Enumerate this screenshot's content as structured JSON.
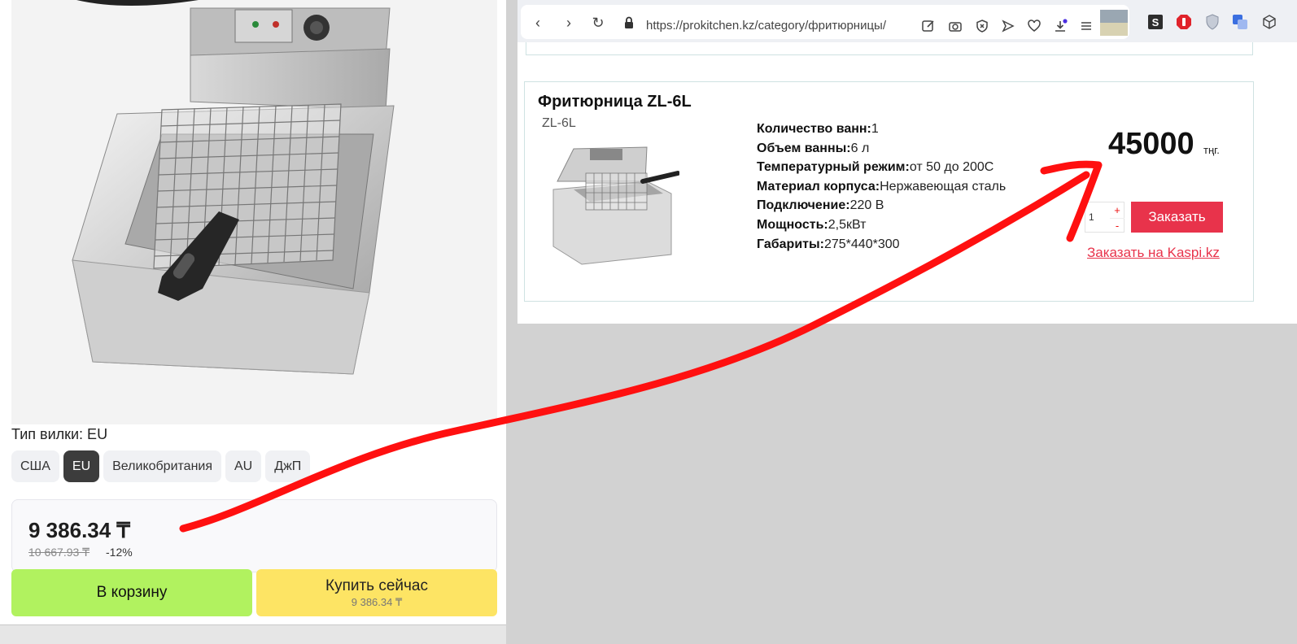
{
  "left_panel": {
    "plug_type_label": "Тип вилки: EU",
    "plug_options": [
      "США",
      "EU",
      "Великобритания",
      "AU",
      "ДжП"
    ],
    "selected_plug": "EU",
    "price": {
      "current": "9 386.34 ₸",
      "old": "10 667.93 ₸",
      "discount": "-12%"
    },
    "buttons": {
      "cart": "В корзину",
      "buy_now": "Купить сейчас",
      "buy_now_sub": "9 386.34 ₸"
    }
  },
  "browser": {
    "url": "https://prokitchen.kz/category/фритюрницы/",
    "toolbar_icons": [
      "edit-icon",
      "camera-icon",
      "shield-x-icon",
      "send-icon",
      "heart-icon",
      "download-icon",
      "menu-icon"
    ],
    "extension_icons": [
      "s-extension-icon",
      "stop-extension-icon",
      "shield-extension-icon",
      "translate-extension-icon",
      "cube-extension-icon"
    ]
  },
  "product_card": {
    "title": "Фритюрница ZL-6L",
    "model": "ZL-6L",
    "specs": [
      {
        "label": "Количество ванн:",
        "value": "1"
      },
      {
        "label": "Объем ванны:",
        "value": "6 л"
      },
      {
        "label": "Температурный режим:",
        "value": "от 50 до 200С"
      },
      {
        "label": "Материал корпуса:",
        "value": "Нержавеющая сталь"
      },
      {
        "label": "Подключение:",
        "value": "220 В"
      },
      {
        "label": "Мощность:",
        "value": "2,5кВт"
      },
      {
        "label": "Габариты:",
        "value": "275*440*300"
      }
    ],
    "price": "45000",
    "currency": "тңг.",
    "quantity": "1",
    "qty_plus": "+",
    "qty_minus": "-",
    "order_button": "Заказать",
    "kaspi_link": "Заказать на Kaspi.kz"
  },
  "colors": {
    "annotation_arrow": "#ff1010",
    "order_button": "#e8334b",
    "cart_button": "#b1f25f",
    "buy_button": "#fde464"
  }
}
